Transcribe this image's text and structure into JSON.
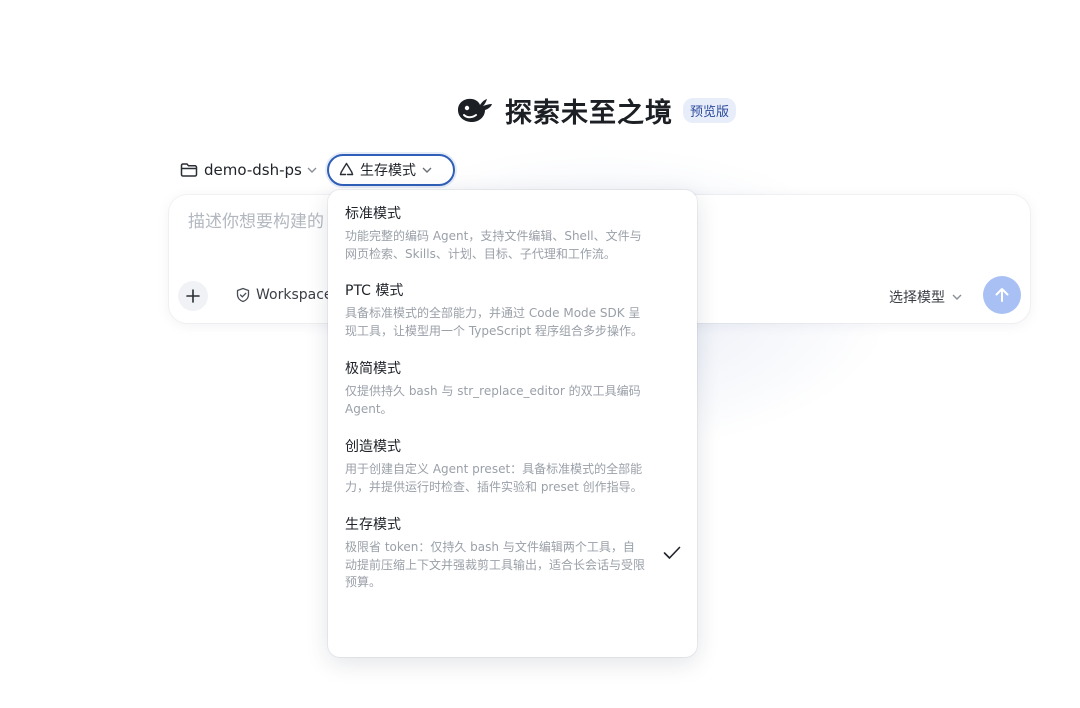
{
  "brand": {
    "title": "探索未至之境",
    "badge": "预览版"
  },
  "project": {
    "label": "demo-dsh-ps"
  },
  "mode": {
    "selected_label": "生存模式"
  },
  "prompt": {
    "placeholder": "描述你想要构建的",
    "workspace_label": "Workspace",
    "model_label": "选择模型"
  },
  "menu": {
    "items": [
      {
        "title": "标准模式",
        "desc": "功能完整的编码 Agent，支持文件编辑、Shell、文件与网页检索、Skills、计划、目标、子代理和工作流。",
        "selected": false
      },
      {
        "title": "PTC 模式",
        "desc": "具备标准模式的全部能力，并通过 Code Mode SDK 呈现工具，让模型用一个 TypeScript 程序组合多步操作。",
        "selected": false
      },
      {
        "title": "极简模式",
        "desc": "仅提供持久 bash 与 str_replace_editor 的双工具编码 Agent。",
        "selected": false
      },
      {
        "title": "创造模式",
        "desc": "用于创建自定义 Agent preset：具备标准模式的全部能力，并提供运行时检查、插件实验和 preset 创作指导。",
        "selected": false
      },
      {
        "title": "生存模式",
        "desc": "极限省 token：仅持久 bash 与文件编辑两个工具，自动提前压缩上下文并强裁剪工具输出，适合长会话与受限预算。",
        "selected": true
      }
    ]
  },
  "colors": {
    "accent": "#2f5fb8",
    "send_button": "#a9c0f4",
    "badge_bg": "#e8edfa",
    "badge_text": "#2c4b9c"
  },
  "icons": {
    "logo": "whale-logo-icon",
    "project": "folder-icon",
    "mode": "recycle-icon",
    "add": "plus-icon",
    "workspace": "shield-check-icon",
    "send": "arrow-up-icon",
    "selected": "check-icon"
  }
}
